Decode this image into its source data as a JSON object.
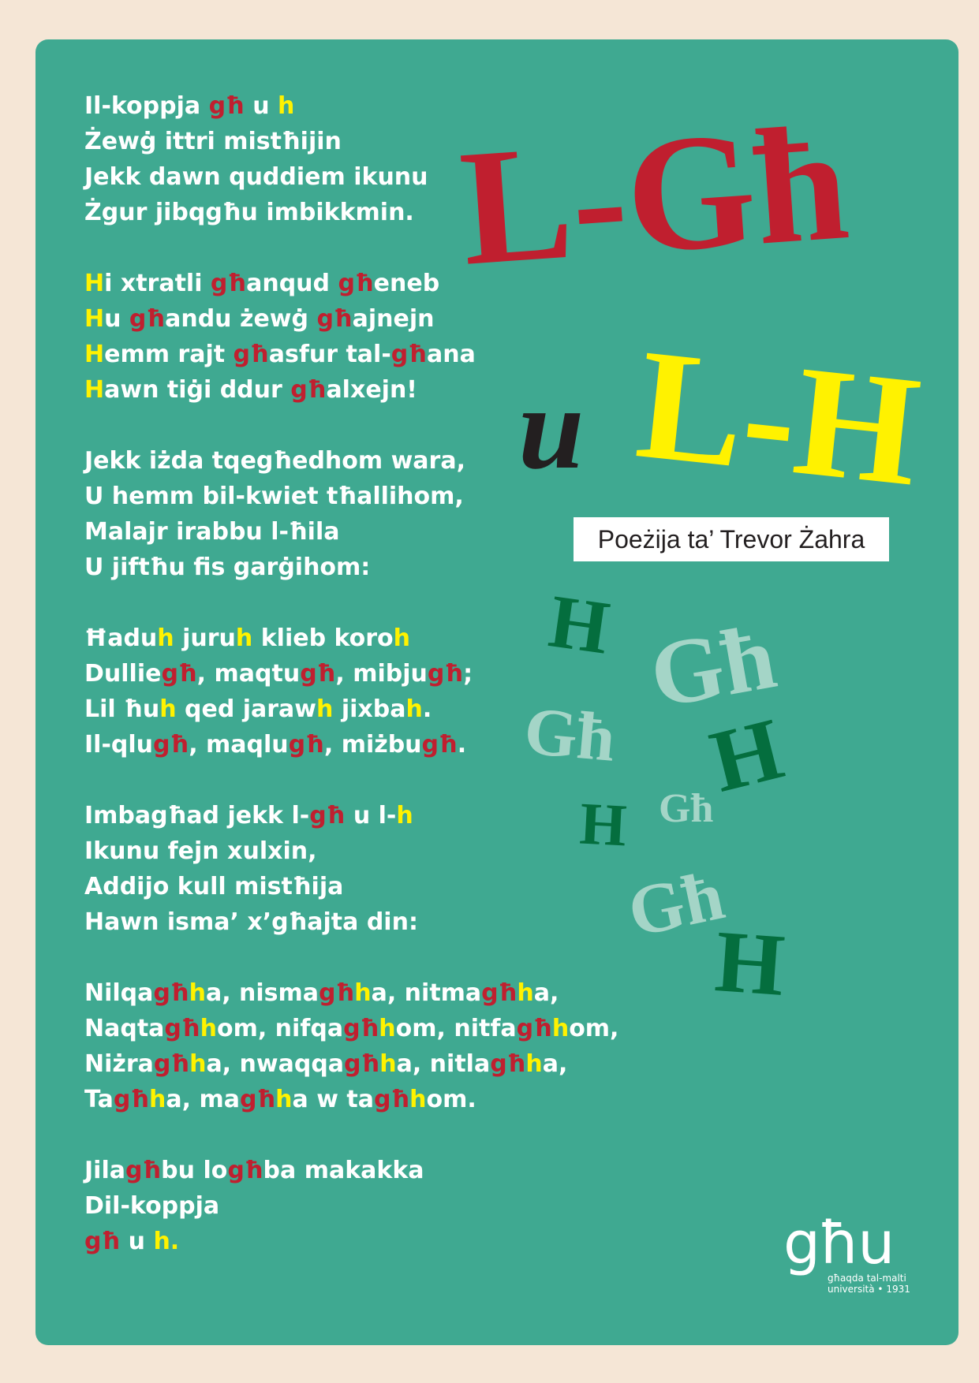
{
  "title": {
    "gh": "L-Għ",
    "u": "u",
    "h": "L-H"
  },
  "author": "Poeżija ta’ Trevor Żahra",
  "stanzas": [
    [
      [
        [
          "Il-koppja ",
          "w"
        ],
        [
          "għ",
          "r"
        ],
        [
          " u ",
          "w"
        ],
        [
          "h",
          "y"
        ]
      ],
      [
        [
          "Żewġ ittri mistħijin",
          "w"
        ]
      ],
      [
        [
          "Jekk dawn quddiem ikunu",
          "w"
        ]
      ],
      [
        [
          "Żgur jibqgħu imbikkmin.",
          "w"
        ]
      ]
    ],
    [
      [
        [
          "H",
          "y"
        ],
        [
          "i xtratli ",
          "w"
        ],
        [
          "għ",
          "r"
        ],
        [
          "anqud ",
          "w"
        ],
        [
          "għ",
          "r"
        ],
        [
          "eneb",
          "w"
        ]
      ],
      [
        [
          "H",
          "y"
        ],
        [
          "u ",
          "w"
        ],
        [
          "għ",
          "r"
        ],
        [
          "andu żewġ ",
          "w"
        ],
        [
          "għ",
          "r"
        ],
        [
          "ajnejn",
          "w"
        ]
      ],
      [
        [
          "H",
          "y"
        ],
        [
          "emm rajt ",
          "w"
        ],
        [
          "għ",
          "r"
        ],
        [
          "asfur tal-",
          "w"
        ],
        [
          "għ",
          "r"
        ],
        [
          "ana",
          "w"
        ]
      ],
      [
        [
          "H",
          "y"
        ],
        [
          "awn tiġi ddur ",
          "w"
        ],
        [
          "għ",
          "r"
        ],
        [
          "alxejn!",
          "w"
        ]
      ]
    ],
    [
      [
        [
          "Jekk iżda tqegħedhom wara,",
          "w"
        ]
      ],
      [
        [
          "U hemm bil-kwiet tħallihom,",
          "w"
        ]
      ],
      [
        [
          "Malajr irabbu l-ħila",
          "w"
        ]
      ],
      [
        [
          "U jiftħu fis garġihom:",
          "w"
        ]
      ]
    ],
    [
      [
        [
          "Ħadu",
          "w"
        ],
        [
          "h",
          "y"
        ],
        [
          " juru",
          "w"
        ],
        [
          "h",
          "y"
        ],
        [
          " klieb koro",
          "w"
        ],
        [
          "h",
          "y"
        ]
      ],
      [
        [
          "Dullie",
          "w"
        ],
        [
          "għ",
          "r"
        ],
        [
          ", maqtu",
          "w"
        ],
        [
          "għ",
          "r"
        ],
        [
          ", mibju",
          "w"
        ],
        [
          "għ",
          "r"
        ],
        [
          ";",
          "w"
        ]
      ],
      [
        [
          "Lil ħu",
          "w"
        ],
        [
          "h",
          "y"
        ],
        [
          " qed jaraw",
          "w"
        ],
        [
          "h",
          "y"
        ],
        [
          " jixba",
          "w"
        ],
        [
          "h",
          "y"
        ],
        [
          ".",
          "w"
        ]
      ],
      [
        [
          "Il-qlu",
          "w"
        ],
        [
          "għ",
          "r"
        ],
        [
          ", maqlu",
          "w"
        ],
        [
          "għ",
          "r"
        ],
        [
          ", miżbu",
          "w"
        ],
        [
          "għ",
          "r"
        ],
        [
          ".",
          "w"
        ]
      ]
    ],
    [
      [
        [
          "Imbagħad jekk l-",
          "w"
        ],
        [
          "għ",
          "r"
        ],
        [
          " u l-",
          "w"
        ],
        [
          "h",
          "y"
        ]
      ],
      [
        [
          "Ikunu fejn xulxin,",
          "w"
        ]
      ],
      [
        [
          "Addijo kull mistħija",
          "w"
        ]
      ],
      [
        [
          "Hawn isma’ x’għajta din:",
          "w"
        ]
      ]
    ],
    [
      [
        [
          "Nilqa",
          "w"
        ],
        [
          "għ",
          "r"
        ],
        [
          "h",
          "y"
        ],
        [
          "a, nisma",
          "w"
        ],
        [
          "għ",
          "r"
        ],
        [
          "h",
          "y"
        ],
        [
          "a, nitma",
          "w"
        ],
        [
          "għ",
          "r"
        ],
        [
          "h",
          "y"
        ],
        [
          "a,",
          "w"
        ]
      ],
      [
        [
          "Naqta",
          "w"
        ],
        [
          "għ",
          "r"
        ],
        [
          "h",
          "y"
        ],
        [
          "om, nifqa",
          "w"
        ],
        [
          "għ",
          "r"
        ],
        [
          "h",
          "y"
        ],
        [
          "om, nitfa",
          "w"
        ],
        [
          "għ",
          "r"
        ],
        [
          "h",
          "y"
        ],
        [
          "om,",
          "w"
        ]
      ],
      [
        [
          "Niżra",
          "w"
        ],
        [
          "għ",
          "r"
        ],
        [
          "h",
          "y"
        ],
        [
          "a, nwaqqa",
          "w"
        ],
        [
          "għ",
          "r"
        ],
        [
          "h",
          "y"
        ],
        [
          "a, nitla",
          "w"
        ],
        [
          "għ",
          "r"
        ],
        [
          "h",
          "y"
        ],
        [
          "a,",
          "w"
        ]
      ],
      [
        [
          "Ta",
          "w"
        ],
        [
          "għ",
          "r"
        ],
        [
          "h",
          "y"
        ],
        [
          "a, ma",
          "w"
        ],
        [
          "għ",
          "r"
        ],
        [
          "h",
          "y"
        ],
        [
          "a w ta",
          "w"
        ],
        [
          "għ",
          "r"
        ],
        [
          "h",
          "y"
        ],
        [
          "om.",
          "w"
        ]
      ]
    ],
    [
      [
        [
          "Jila",
          "w"
        ],
        [
          "għ",
          "r"
        ],
        [
          "bu lo",
          "w"
        ],
        [
          "għ",
          "r"
        ],
        [
          "ba makakka",
          "w"
        ]
      ],
      [
        [
          "Dil-koppja",
          "w"
        ]
      ],
      [
        [
          "għ",
          "r"
        ],
        [
          " u ",
          "w"
        ],
        [
          "h.",
          "y"
        ]
      ]
    ]
  ],
  "decorations": [
    {
      "text": "H",
      "tone": "dark"
    },
    {
      "text": "Għ",
      "tone": "light"
    },
    {
      "text": "Għ",
      "tone": "light"
    },
    {
      "text": "H",
      "tone": "dark"
    },
    {
      "text": "Għ",
      "tone": "light"
    },
    {
      "text": "H",
      "tone": "dark"
    },
    {
      "text": "Għ",
      "tone": "light"
    },
    {
      "text": "H",
      "tone": "dark"
    }
  ],
  "logo": {
    "mark": "għu",
    "line1": "għaqda tal-malti",
    "line2": "università • 1931"
  },
  "colors": {
    "background": "#f5e6d6",
    "card": "#3fa991",
    "gh_red": "#c01f2f",
    "h_yellow": "#fff200",
    "text_white": "#ffffff",
    "deco_dark": "#046e3e",
    "deco_light": "#a4d5c7"
  }
}
